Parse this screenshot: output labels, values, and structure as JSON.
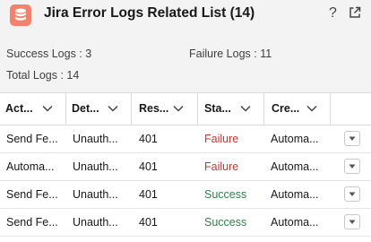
{
  "header": {
    "title": "Jira Error Logs Related List (14)",
    "help_glyph": "?",
    "object_icon": "database-icon",
    "icon_color": "#f2826b"
  },
  "summary": {
    "success": "Success Logs : 3",
    "failure": "Failure Logs : 11",
    "total": "Total Logs : 14"
  },
  "table": {
    "columns": [
      "Act...",
      "Det...",
      "Res...",
      "Sta...",
      "Cre..."
    ],
    "rows": [
      {
        "action": "Send Fe...",
        "details": "Unauth...",
        "response": "401",
        "status": "Failure",
        "created": "Automa..."
      },
      {
        "action": "Automa...",
        "details": "Unauth...",
        "response": "401",
        "status": "Failure",
        "created": "Automa..."
      },
      {
        "action": "Send Fe...",
        "details": "Unauth...",
        "response": "401",
        "status": "Success",
        "created": "Automa..."
      },
      {
        "action": "Send Fe...",
        "details": "Unauth...",
        "response": "401",
        "status": "Success",
        "created": "Automa..."
      }
    ]
  },
  "colors": {
    "failure": "#c23934",
    "success": "#2e844a",
    "header_bg": "#f3f3f3"
  }
}
